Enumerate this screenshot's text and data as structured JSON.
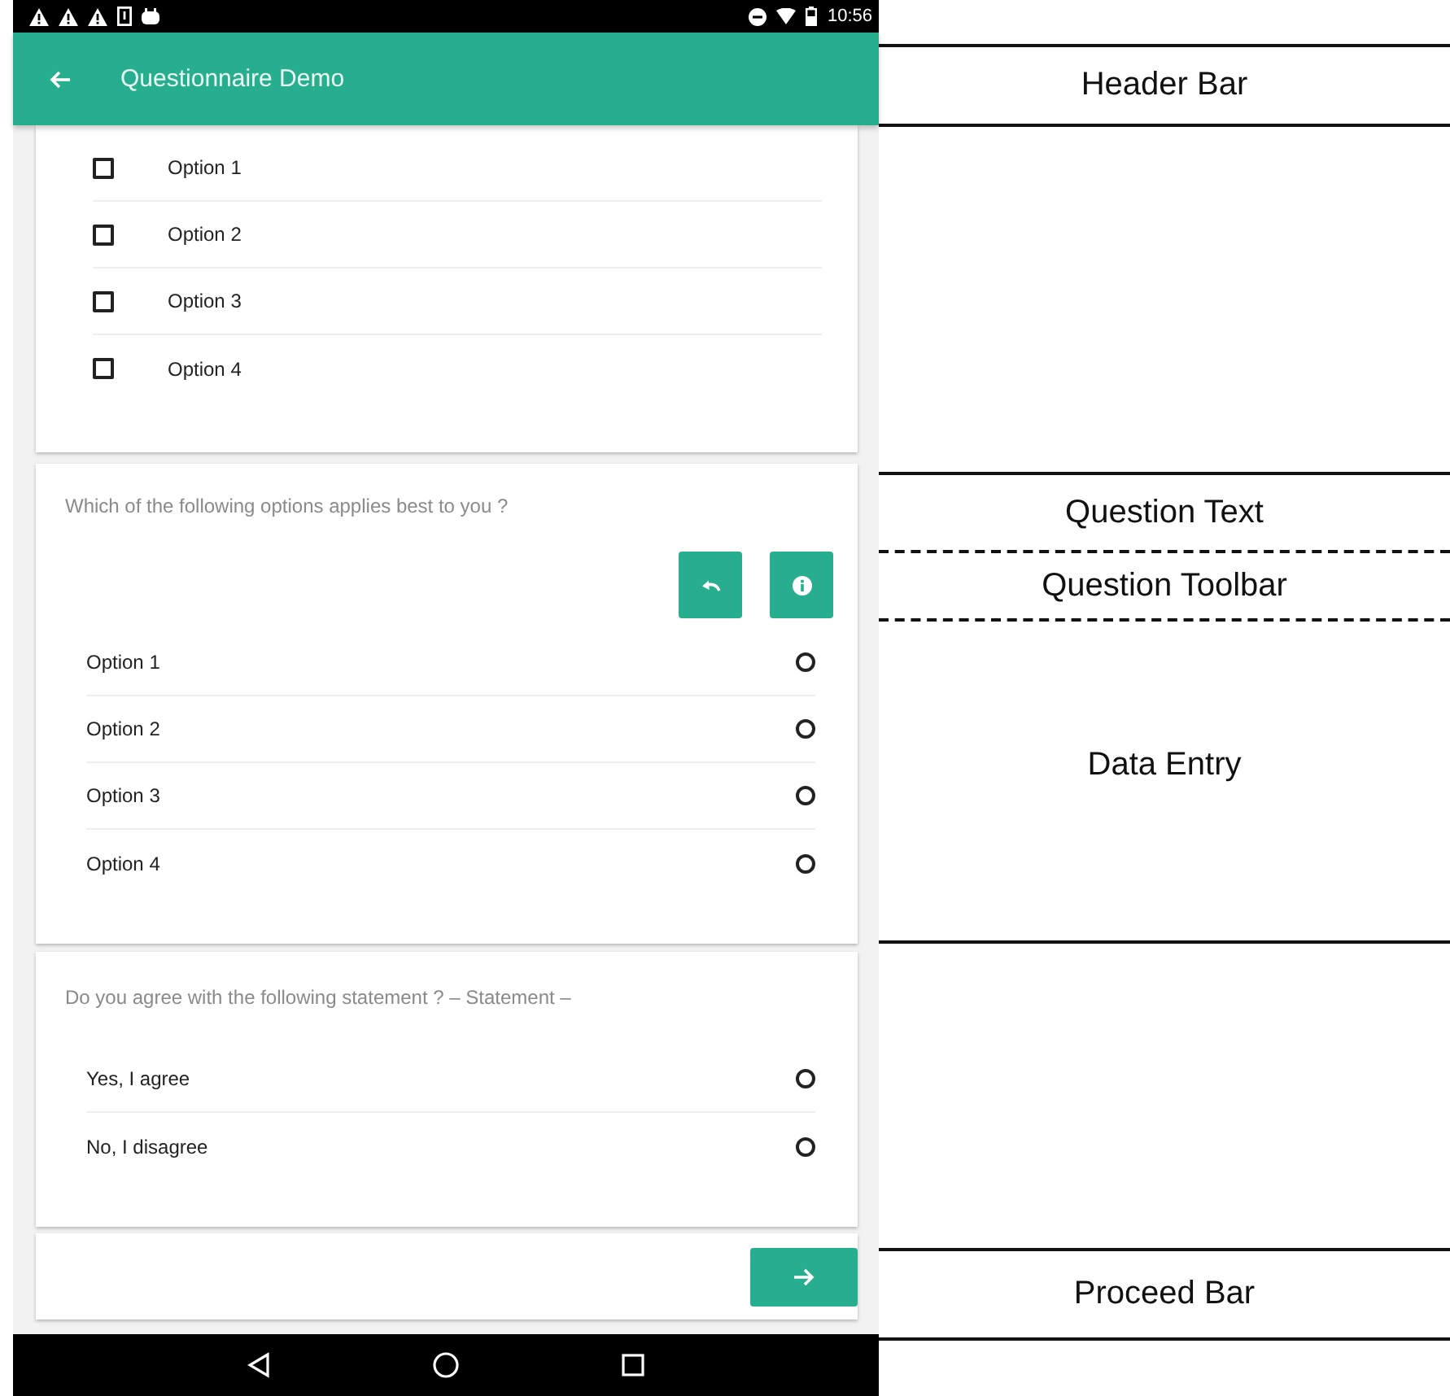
{
  "status_bar": {
    "time": "10:56"
  },
  "app_bar": {
    "title": "Questionnaire Demo"
  },
  "questions": [
    {
      "kind": "checkbox",
      "toolbar": false,
      "options": [
        {
          "label": "Option 1",
          "checked": false
        },
        {
          "label": "Option 2",
          "checked": false
        },
        {
          "label": "Option 3",
          "checked": false
        },
        {
          "label": "Option 4",
          "checked": false
        }
      ]
    },
    {
      "kind": "radio",
      "text": "Which of the following options applies best to you ?",
      "toolbar": true,
      "options": [
        {
          "label": "Option 1",
          "selected": false
        },
        {
          "label": "Option 2",
          "selected": false
        },
        {
          "label": "Option 3",
          "selected": false
        },
        {
          "label": "Option 4",
          "selected": false
        }
      ]
    },
    {
      "kind": "radio",
      "text": "Do you agree with the following statement ? – Statement –",
      "toolbar": false,
      "options": [
        {
          "label": "Yes, I agree",
          "selected": false
        },
        {
          "label": "No, I disagree",
          "selected": false
        }
      ]
    }
  ],
  "annotations": [
    {
      "label": "Header Bar",
      "kind": "boxed"
    },
    {
      "label": "Question Text",
      "kind": "opening"
    },
    {
      "label": "Question Toolbar",
      "kind": "inner"
    },
    {
      "label": "Data Entry",
      "kind": "closing"
    },
    {
      "label": "Proceed Bar",
      "kind": "boxed"
    }
  ]
}
